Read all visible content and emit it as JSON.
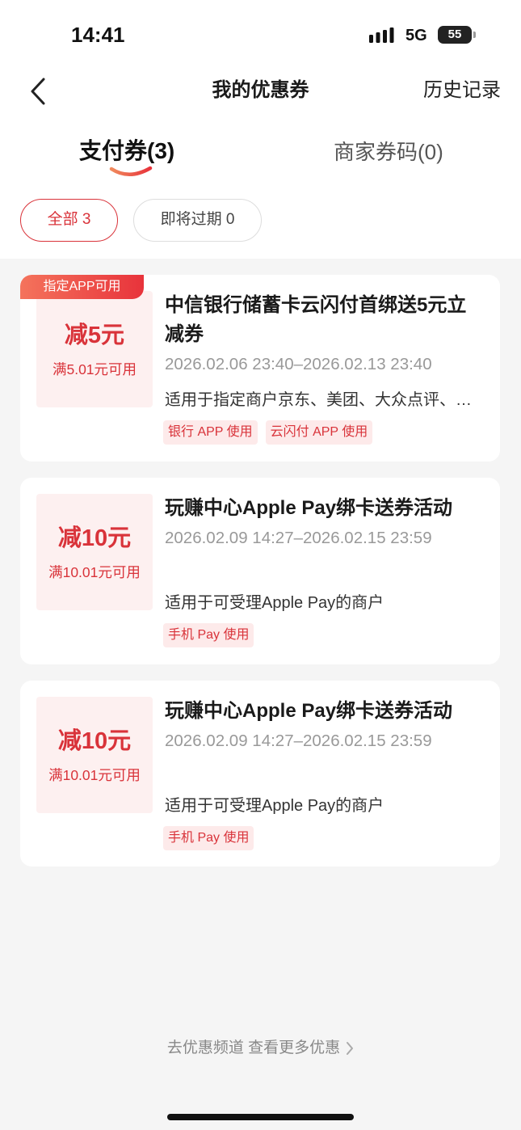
{
  "status_bar": {
    "time": "14:41",
    "network": "5G",
    "battery": "55",
    "signal_icon": "signal-bars-icon"
  },
  "nav": {
    "title": "我的优惠券",
    "history_label": "历史记录",
    "back_icon": "chevron-left-icon"
  },
  "tabs": [
    {
      "label": "支付券(3)",
      "active": true
    },
    {
      "label": "商家券码(0)",
      "active": false
    }
  ],
  "filters": [
    {
      "label": "全部 3",
      "active": true
    },
    {
      "label": "即将过期 0",
      "active": false
    }
  ],
  "coupons": [
    {
      "badge": "指定APP可用",
      "amount": "减5元",
      "condition": "满5.01元可用",
      "title": "中信银行储蓄卡云闪付首绑送5元立减券",
      "validity": "2026.02.06 23:40–2026.02.13 23:40",
      "scope": "适用于指定商户京东、美团、大众点评、饿…",
      "tags": [
        "银行 APP 使用",
        "云闪付 APP 使用"
      ]
    },
    {
      "amount": "减10元",
      "condition": "满10.01元可用",
      "title": "玩赚中心Apple Pay绑卡送券活动",
      "validity": "2026.02.09 14:27–2026.02.15 23:59",
      "scope": "适用于可受理Apple Pay的商户",
      "tags": [
        "手机 Pay 使用"
      ]
    },
    {
      "amount": "减10元",
      "condition": "满10.01元可用",
      "title": "玩赚中心Apple Pay绑卡送券活动",
      "validity": "2026.02.09 14:27–2026.02.15 23:59",
      "scope": "适用于可受理Apple Pay的商户",
      "tags": [
        "手机 Pay 使用"
      ]
    }
  ],
  "footer": {
    "link_label": "去优惠频道 查看更多优惠",
    "icon": "chevron-right-icon"
  },
  "colors": {
    "accent": "#d9333a",
    "page_bg": "#f5f5f5",
    "amount_box_bg": "#fdf0f0",
    "tag_bg": "#fdeaea",
    "badge_gradient": [
      "#f4735c",
      "#e8333b"
    ],
    "muted_text": "#999999"
  }
}
